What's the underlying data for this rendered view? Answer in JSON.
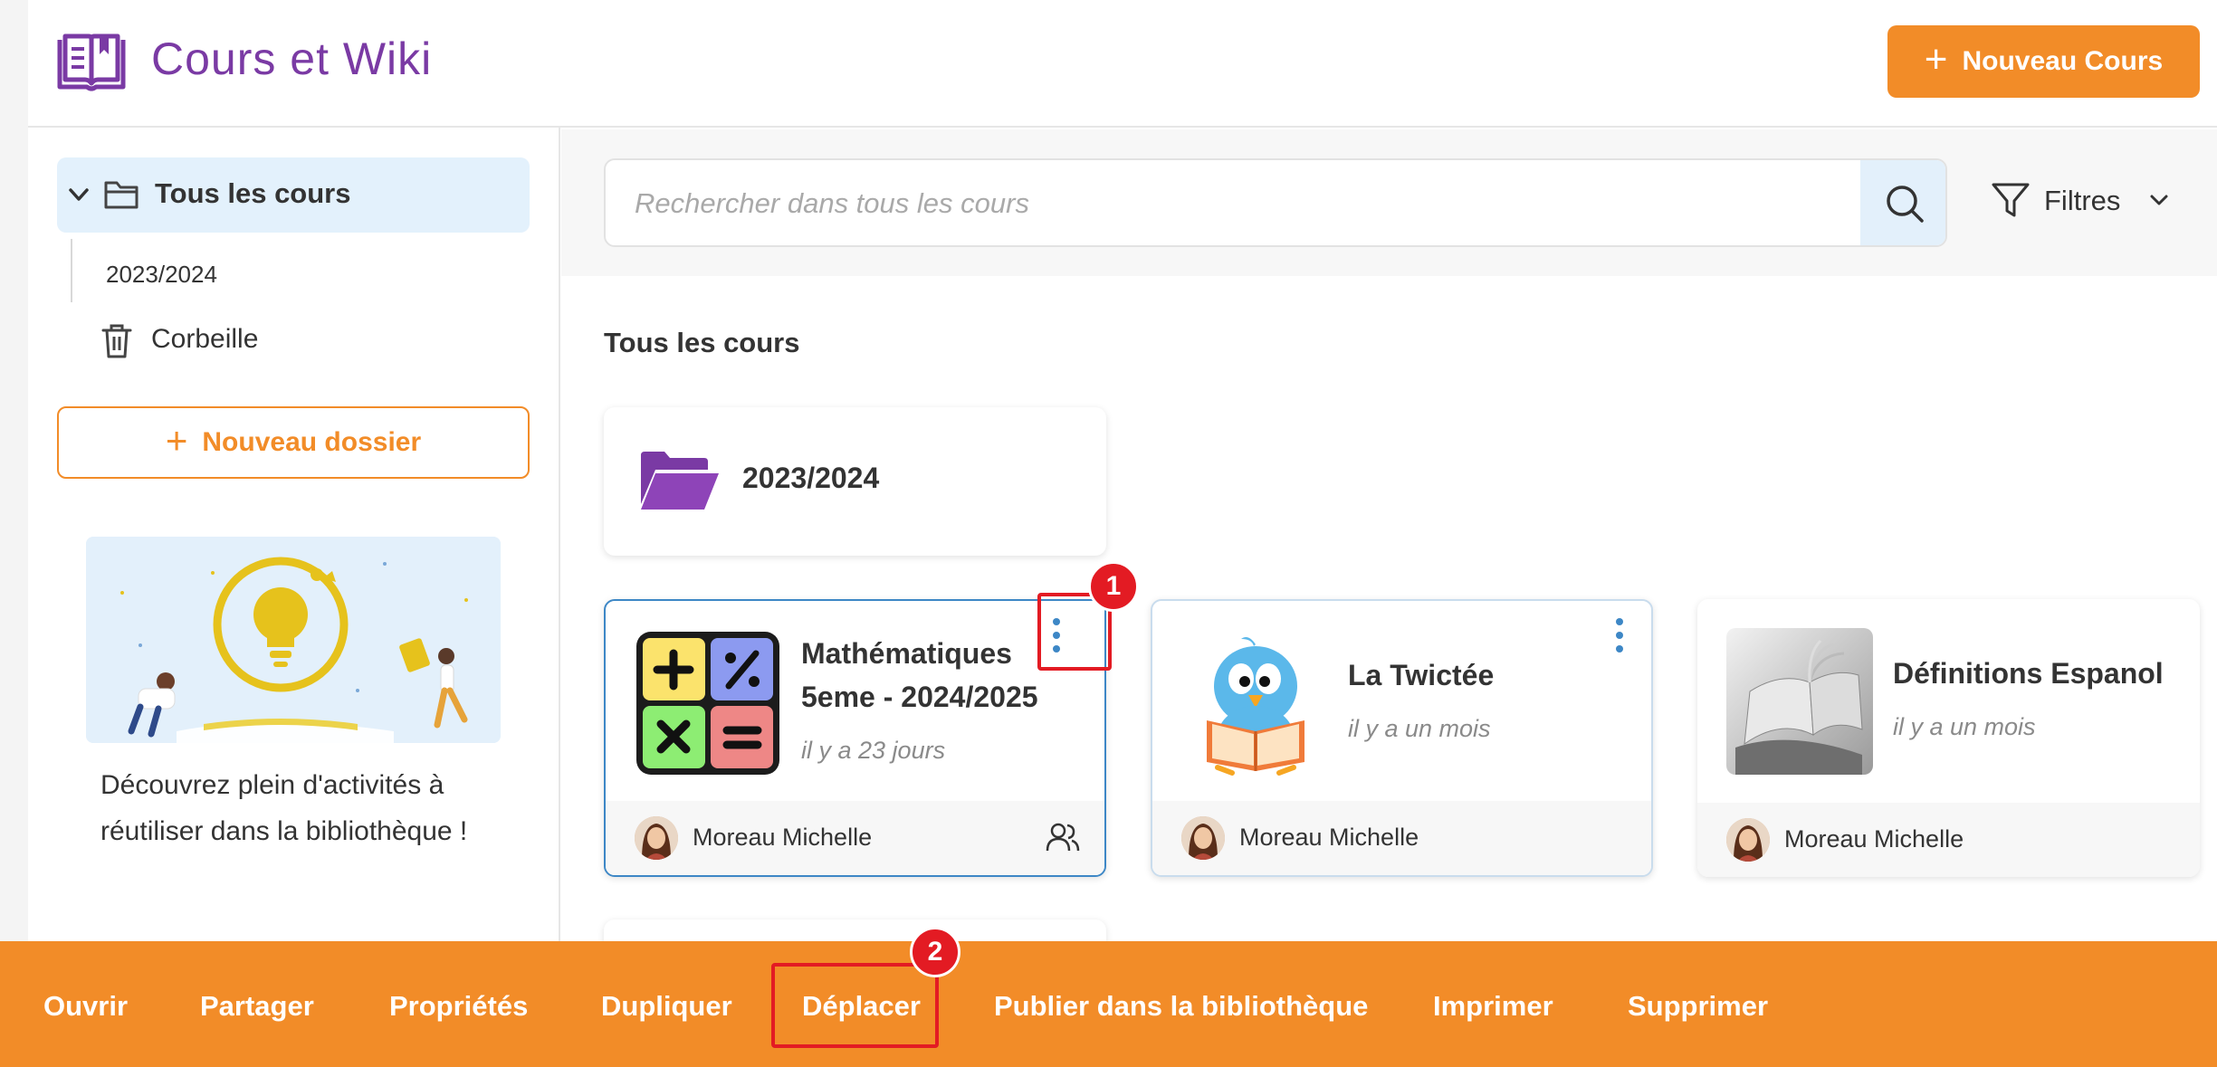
{
  "header": {
    "app_title": "Cours et Wiki",
    "new_course_label": "Nouveau Cours",
    "accent_color": "#f28c28",
    "brand_color": "#7a3aa4"
  },
  "sidebar": {
    "root_label": "Tous les cours",
    "children": [
      "2023/2024"
    ],
    "trash_label": "Corbeille",
    "new_folder_label": "Nouveau dossier",
    "promo_text": "Découvrez plein d'activités à réutiliser dans la bibliothèque !"
  },
  "search": {
    "placeholder": "Rechercher dans tous les cours",
    "value": ""
  },
  "filters": {
    "label": "Filtres"
  },
  "main": {
    "section_title": "Tous les cours",
    "folders": [
      {
        "label": "2023/2024"
      }
    ],
    "courses": [
      {
        "title_line1": "Mathématiques",
        "title_line2": "5eme - 2024/2025",
        "date": "il y a 23 jours",
        "author": "Moreau Michelle",
        "shared": true,
        "selected": true
      },
      {
        "title_line1": "La Twictée",
        "date": "il y a un mois",
        "author": "Moreau Michelle",
        "shared": false,
        "selected": false
      },
      {
        "title_line1": "Définitions Espanol",
        "date": "il y a un mois",
        "author": "Moreau Michelle",
        "shared": false,
        "selected": false
      }
    ]
  },
  "action_bar": {
    "actions": [
      "Ouvrir",
      "Partager",
      "Propriétés",
      "Dupliquer",
      "Déplacer",
      "Publier dans la bibliothèque",
      "Imprimer",
      "Supprimer"
    ]
  },
  "callouts": [
    "1",
    "2"
  ],
  "icons": [
    "book-icon",
    "plus-icon",
    "chevron-down-icon",
    "folder-icon",
    "trash-icon",
    "search-icon",
    "filter-icon",
    "kebab-menu-icon",
    "users-icon"
  ]
}
